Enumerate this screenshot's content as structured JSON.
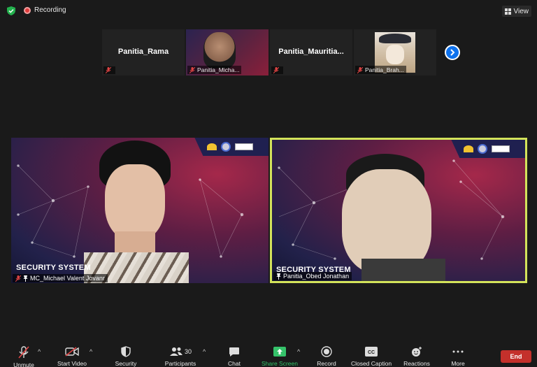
{
  "topbar": {
    "recording_label": "Recording",
    "view_label": "View"
  },
  "gallery_strip": [
    {
      "big_name": "Panitia_Rama",
      "label": ""
    },
    {
      "big_name": "",
      "label": "Panitia_Micha..."
    },
    {
      "big_name": "Panitia_Mauritia...",
      "label": ""
    },
    {
      "big_name": "",
      "label": "Panitia_Brah..."
    }
  ],
  "main_videos": [
    {
      "background_text": "SECURITY SYSTEM",
      "name": "MC_Michael Valent Jovanr"
    },
    {
      "background_text": "SECURITY SYSTEM",
      "name": "Panitia_Obed Jonathan"
    }
  ],
  "toolbar": {
    "unmute": "Unmute",
    "start_video": "Start Video",
    "security": "Security",
    "participants": "Participants",
    "participants_count": "30",
    "chat": "Chat",
    "share_screen": "Share Screen",
    "record": "Record",
    "closed_caption": "Closed Caption",
    "reactions": "Reactions",
    "more": "More",
    "end": "End"
  },
  "colors": {
    "share_green": "#35c26a",
    "active_speaker_border": "#d3e35a",
    "end_red": "#c4302b",
    "next_blue": "#0e72ed"
  }
}
